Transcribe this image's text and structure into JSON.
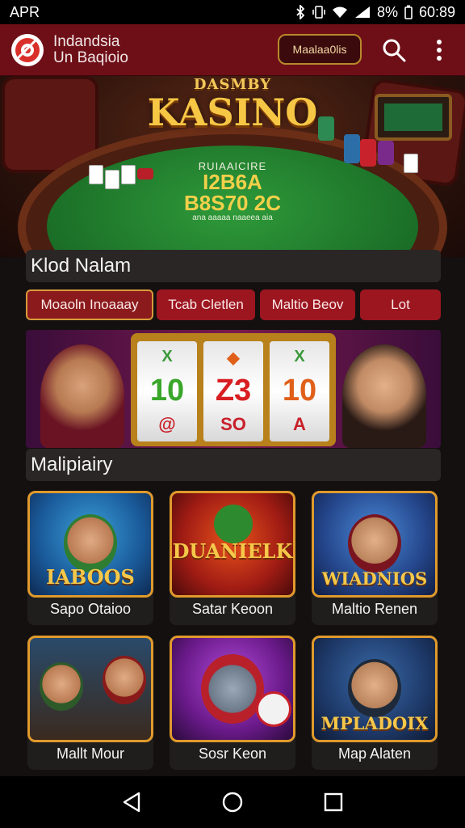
{
  "status_bar": {
    "left_text": "APR",
    "battery": "8%",
    "time": "60:89"
  },
  "header": {
    "title_line1": "Indandsia",
    "title_line2": "Un Baqioio",
    "action_button": "Maalaa0lis"
  },
  "hero": {
    "title_small": "DASMBY",
    "title_main": "KASINO",
    "felt_caption": "RUIAAICIRE",
    "felt_row1": "I2B6A",
    "felt_row2": "B8S70 2C",
    "felt_sub": "ana aaaaa naaeea aia"
  },
  "section1": {
    "title": "Klod Nalam"
  },
  "tabs": [
    {
      "label": "Moaoln Inoaaay"
    },
    {
      "label": "Tcab Cletlen"
    },
    {
      "label": "Maltio Beov"
    },
    {
      "label": "Lot"
    }
  ],
  "banner": {
    "reels": [
      {
        "top": "X",
        "mid": "10",
        "bot": "@"
      },
      {
        "top": "◆",
        "mid": "Z3",
        "bot": "SO"
      },
      {
        "top": "X",
        "mid": "10",
        "bot": "A"
      }
    ]
  },
  "section2": {
    "title": "Malipiairy"
  },
  "games": [
    {
      "art_title": "IABOOS",
      "label": "Sapo Otaioo"
    },
    {
      "art_title": "DUANIELK",
      "label": "Satar Keoon"
    },
    {
      "art_title": "WIADNIOS",
      "label": "Maltio Renen"
    },
    {
      "art_title": "",
      "label": "Mallt Mour"
    },
    {
      "art_title": "",
      "label": "Sosr Keon"
    },
    {
      "art_title": "MPLADOIX",
      "label": "Map Alaten"
    }
  ]
}
